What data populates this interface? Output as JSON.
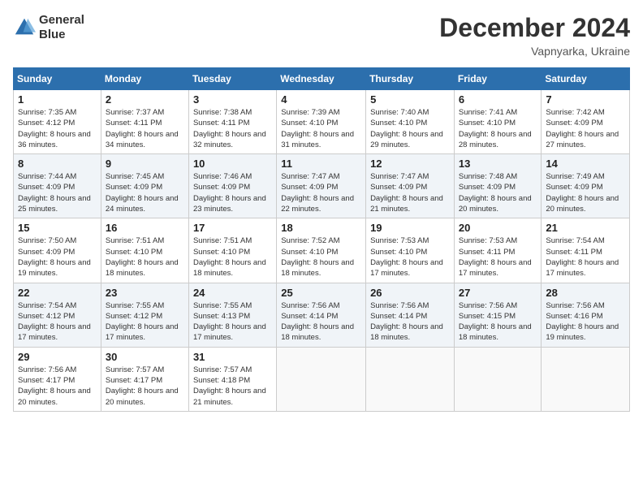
{
  "header": {
    "logo_line1": "General",
    "logo_line2": "Blue",
    "title": "December 2024",
    "subtitle": "Vapnyarka, Ukraine"
  },
  "columns": [
    "Sunday",
    "Monday",
    "Tuesday",
    "Wednesday",
    "Thursday",
    "Friday",
    "Saturday"
  ],
  "weeks": [
    [
      {
        "day": "1",
        "sunrise": "Sunrise: 7:35 AM",
        "sunset": "Sunset: 4:12 PM",
        "daylight": "Daylight: 8 hours and 36 minutes."
      },
      {
        "day": "2",
        "sunrise": "Sunrise: 7:37 AM",
        "sunset": "Sunset: 4:11 PM",
        "daylight": "Daylight: 8 hours and 34 minutes."
      },
      {
        "day": "3",
        "sunrise": "Sunrise: 7:38 AM",
        "sunset": "Sunset: 4:11 PM",
        "daylight": "Daylight: 8 hours and 32 minutes."
      },
      {
        "day": "4",
        "sunrise": "Sunrise: 7:39 AM",
        "sunset": "Sunset: 4:10 PM",
        "daylight": "Daylight: 8 hours and 31 minutes."
      },
      {
        "day": "5",
        "sunrise": "Sunrise: 7:40 AM",
        "sunset": "Sunset: 4:10 PM",
        "daylight": "Daylight: 8 hours and 29 minutes."
      },
      {
        "day": "6",
        "sunrise": "Sunrise: 7:41 AM",
        "sunset": "Sunset: 4:10 PM",
        "daylight": "Daylight: 8 hours and 28 minutes."
      },
      {
        "day": "7",
        "sunrise": "Sunrise: 7:42 AM",
        "sunset": "Sunset: 4:09 PM",
        "daylight": "Daylight: 8 hours and 27 minutes."
      }
    ],
    [
      {
        "day": "8",
        "sunrise": "Sunrise: 7:44 AM",
        "sunset": "Sunset: 4:09 PM",
        "daylight": "Daylight: 8 hours and 25 minutes."
      },
      {
        "day": "9",
        "sunrise": "Sunrise: 7:45 AM",
        "sunset": "Sunset: 4:09 PM",
        "daylight": "Daylight: 8 hours and 24 minutes."
      },
      {
        "day": "10",
        "sunrise": "Sunrise: 7:46 AM",
        "sunset": "Sunset: 4:09 PM",
        "daylight": "Daylight: 8 hours and 23 minutes."
      },
      {
        "day": "11",
        "sunrise": "Sunrise: 7:47 AM",
        "sunset": "Sunset: 4:09 PM",
        "daylight": "Daylight: 8 hours and 22 minutes."
      },
      {
        "day": "12",
        "sunrise": "Sunrise: 7:47 AM",
        "sunset": "Sunset: 4:09 PM",
        "daylight": "Daylight: 8 hours and 21 minutes."
      },
      {
        "day": "13",
        "sunrise": "Sunrise: 7:48 AM",
        "sunset": "Sunset: 4:09 PM",
        "daylight": "Daylight: 8 hours and 20 minutes."
      },
      {
        "day": "14",
        "sunrise": "Sunrise: 7:49 AM",
        "sunset": "Sunset: 4:09 PM",
        "daylight": "Daylight: 8 hours and 20 minutes."
      }
    ],
    [
      {
        "day": "15",
        "sunrise": "Sunrise: 7:50 AM",
        "sunset": "Sunset: 4:09 PM",
        "daylight": "Daylight: 8 hours and 19 minutes."
      },
      {
        "day": "16",
        "sunrise": "Sunrise: 7:51 AM",
        "sunset": "Sunset: 4:10 PM",
        "daylight": "Daylight: 8 hours and 18 minutes."
      },
      {
        "day": "17",
        "sunrise": "Sunrise: 7:51 AM",
        "sunset": "Sunset: 4:10 PM",
        "daylight": "Daylight: 8 hours and 18 minutes."
      },
      {
        "day": "18",
        "sunrise": "Sunrise: 7:52 AM",
        "sunset": "Sunset: 4:10 PM",
        "daylight": "Daylight: 8 hours and 18 minutes."
      },
      {
        "day": "19",
        "sunrise": "Sunrise: 7:53 AM",
        "sunset": "Sunset: 4:10 PM",
        "daylight": "Daylight: 8 hours and 17 minutes."
      },
      {
        "day": "20",
        "sunrise": "Sunrise: 7:53 AM",
        "sunset": "Sunset: 4:11 PM",
        "daylight": "Daylight: 8 hours and 17 minutes."
      },
      {
        "day": "21",
        "sunrise": "Sunrise: 7:54 AM",
        "sunset": "Sunset: 4:11 PM",
        "daylight": "Daylight: 8 hours and 17 minutes."
      }
    ],
    [
      {
        "day": "22",
        "sunrise": "Sunrise: 7:54 AM",
        "sunset": "Sunset: 4:12 PM",
        "daylight": "Daylight: 8 hours and 17 minutes."
      },
      {
        "day": "23",
        "sunrise": "Sunrise: 7:55 AM",
        "sunset": "Sunset: 4:12 PM",
        "daylight": "Daylight: 8 hours and 17 minutes."
      },
      {
        "day": "24",
        "sunrise": "Sunrise: 7:55 AM",
        "sunset": "Sunset: 4:13 PM",
        "daylight": "Daylight: 8 hours and 17 minutes."
      },
      {
        "day": "25",
        "sunrise": "Sunrise: 7:56 AM",
        "sunset": "Sunset: 4:14 PM",
        "daylight": "Daylight: 8 hours and 18 minutes."
      },
      {
        "day": "26",
        "sunrise": "Sunrise: 7:56 AM",
        "sunset": "Sunset: 4:14 PM",
        "daylight": "Daylight: 8 hours and 18 minutes."
      },
      {
        "day": "27",
        "sunrise": "Sunrise: 7:56 AM",
        "sunset": "Sunset: 4:15 PM",
        "daylight": "Daylight: 8 hours and 18 minutes."
      },
      {
        "day": "28",
        "sunrise": "Sunrise: 7:56 AM",
        "sunset": "Sunset: 4:16 PM",
        "daylight": "Daylight: 8 hours and 19 minutes."
      }
    ],
    [
      {
        "day": "29",
        "sunrise": "Sunrise: 7:56 AM",
        "sunset": "Sunset: 4:17 PM",
        "daylight": "Daylight: 8 hours and 20 minutes."
      },
      {
        "day": "30",
        "sunrise": "Sunrise: 7:57 AM",
        "sunset": "Sunset: 4:17 PM",
        "daylight": "Daylight: 8 hours and 20 minutes."
      },
      {
        "day": "31",
        "sunrise": "Sunrise: 7:57 AM",
        "sunset": "Sunset: 4:18 PM",
        "daylight": "Daylight: 8 hours and 21 minutes."
      },
      null,
      null,
      null,
      null
    ]
  ]
}
